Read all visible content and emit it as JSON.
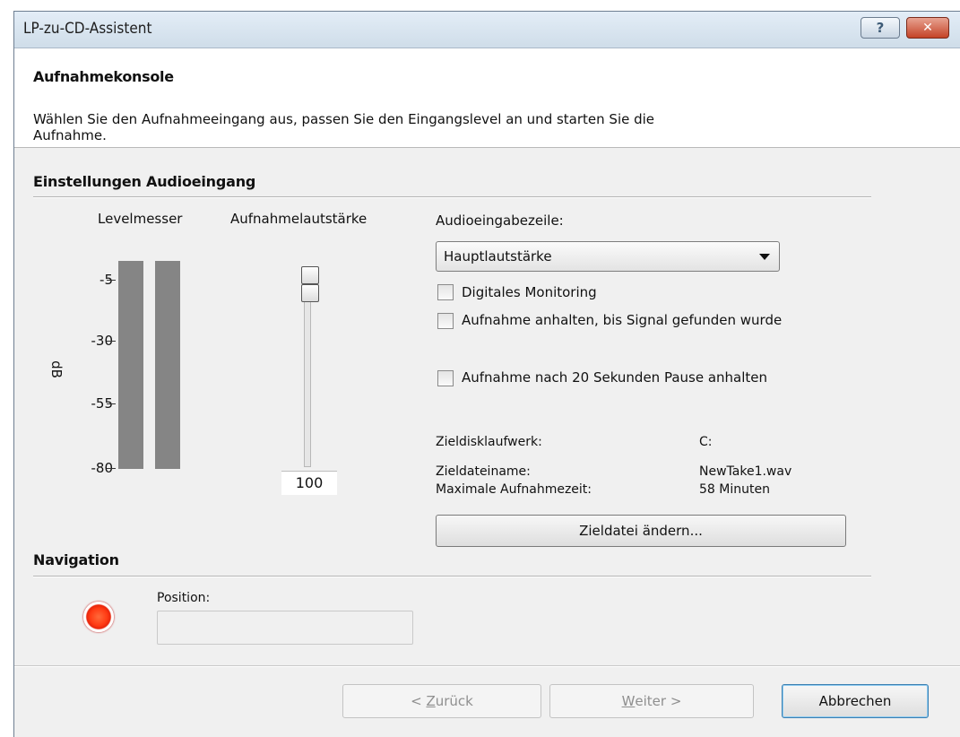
{
  "window": {
    "title": "LP-zu-CD-Assistent",
    "help_label": "?",
    "close_label": "✕"
  },
  "header": {
    "title": "Aufnahmekonsole",
    "description": "Wählen Sie den Aufnahmeeingang aus, passen Sie den Eingangslevel an und starten Sie die Aufnahme."
  },
  "input_settings": {
    "section_title": "Einstellungen Audioeingang",
    "level_meter_label": "Levelmesser",
    "recording_volume_label": "Aufnahmelautstärke",
    "db_unit": "dB",
    "db_ticks": [
      "-5",
      "-30",
      "-55",
      "-80"
    ],
    "volume_value": "100",
    "volume_level_fraction": 1.0,
    "input_line_label": "Audioeingabezeile:",
    "input_line_selected": "Hauptlautstärke",
    "checkboxes": [
      {
        "label": "Digitales Monitoring",
        "checked": false
      },
      {
        "label": "Aufnahme anhalten, bis Signal gefunden wurde",
        "checked": false
      },
      {
        "label": "Aufnahme nach 20 Sekunden Pause anhalten",
        "checked": false
      }
    ],
    "target_drive_label": "Zieldisklaufwerk:",
    "target_drive_value": "C:",
    "target_file_label": "Zieldateiname:",
    "target_file_value": "NewTake1.wav",
    "max_time_label": "Maximale Aufnahmezeit:",
    "max_time_value": "58 Minuten",
    "change_file_button": "Zieldatei ändern..."
  },
  "navigation": {
    "section_title": "Navigation",
    "position_label": "Position:",
    "position_value": ""
  },
  "footer": {
    "back_prefix": "< ",
    "back_mnemonic": "Z",
    "back_rest": "urück",
    "next_mnemonic": "W",
    "next_rest": "eiter >",
    "cancel": "Abbrechen"
  },
  "colors": {
    "meter_bar": "#858585",
    "record_button": "#e8250b",
    "default_button_border": "#3c7fb1"
  }
}
